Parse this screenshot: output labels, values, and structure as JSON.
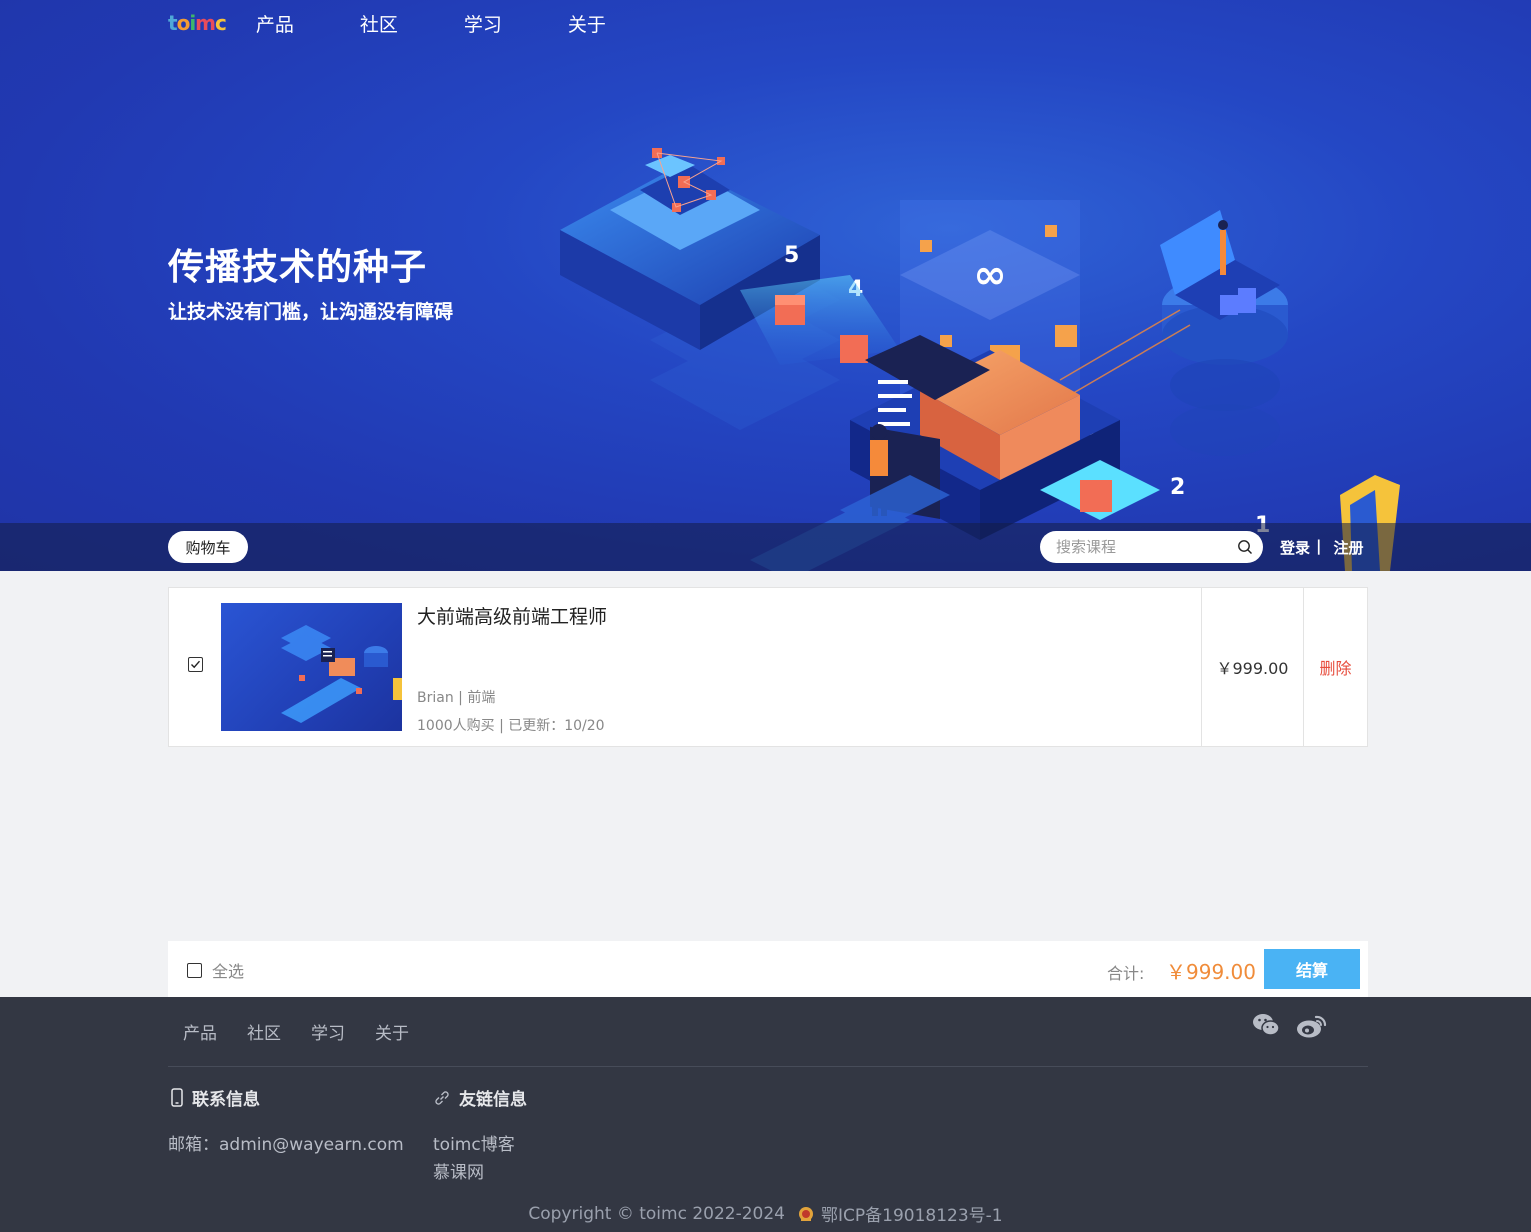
{
  "header": {
    "logo": [
      "t",
      "o",
      "i",
      "m",
      "c"
    ],
    "logo_colors": [
      "#4fa8d8",
      "#f39c34",
      "#3fb56b",
      "#e84c5c",
      "#f5c33b"
    ],
    "nav": [
      "产品",
      "社区",
      "学习",
      "关于"
    ]
  },
  "hero": {
    "title": "传播技术的种子",
    "subtitle": "让技术没有门槛，让沟通没有障碍"
  },
  "toolbar": {
    "cart_label": "购物车",
    "search_placeholder": "搜索课程",
    "login_label": "登录",
    "separator": "|",
    "register_label": "注册"
  },
  "cart": {
    "items": [
      {
        "title": "大前端高级前端工程师",
        "author_tag": "Brian | 前端",
        "stats": "1000人购买 | 已更新：10/20",
        "price": "￥999.00",
        "checked": true,
        "delete_label": "删除"
      }
    ]
  },
  "checkout": {
    "select_all_label": "全选",
    "total_label": "合计:",
    "total_value": "￥999.00",
    "pay_label": "结算"
  },
  "footer": {
    "nav": [
      "产品",
      "社区",
      "学习",
      "关于"
    ],
    "contact_heading": "联系信息",
    "contact_email": "邮箱：admin@wayearn.com",
    "links_heading": "友链信息",
    "links": [
      "toimc博客",
      "慕课网"
    ],
    "copyright": "Copyright © toimc 2022-2024",
    "icp": "鄂ICP备19018123号-1"
  },
  "colors": {
    "accent": "#4ab3f4",
    "price": "#f08c3a",
    "delete": "#e74c3c",
    "footer_bg": "#333743"
  }
}
